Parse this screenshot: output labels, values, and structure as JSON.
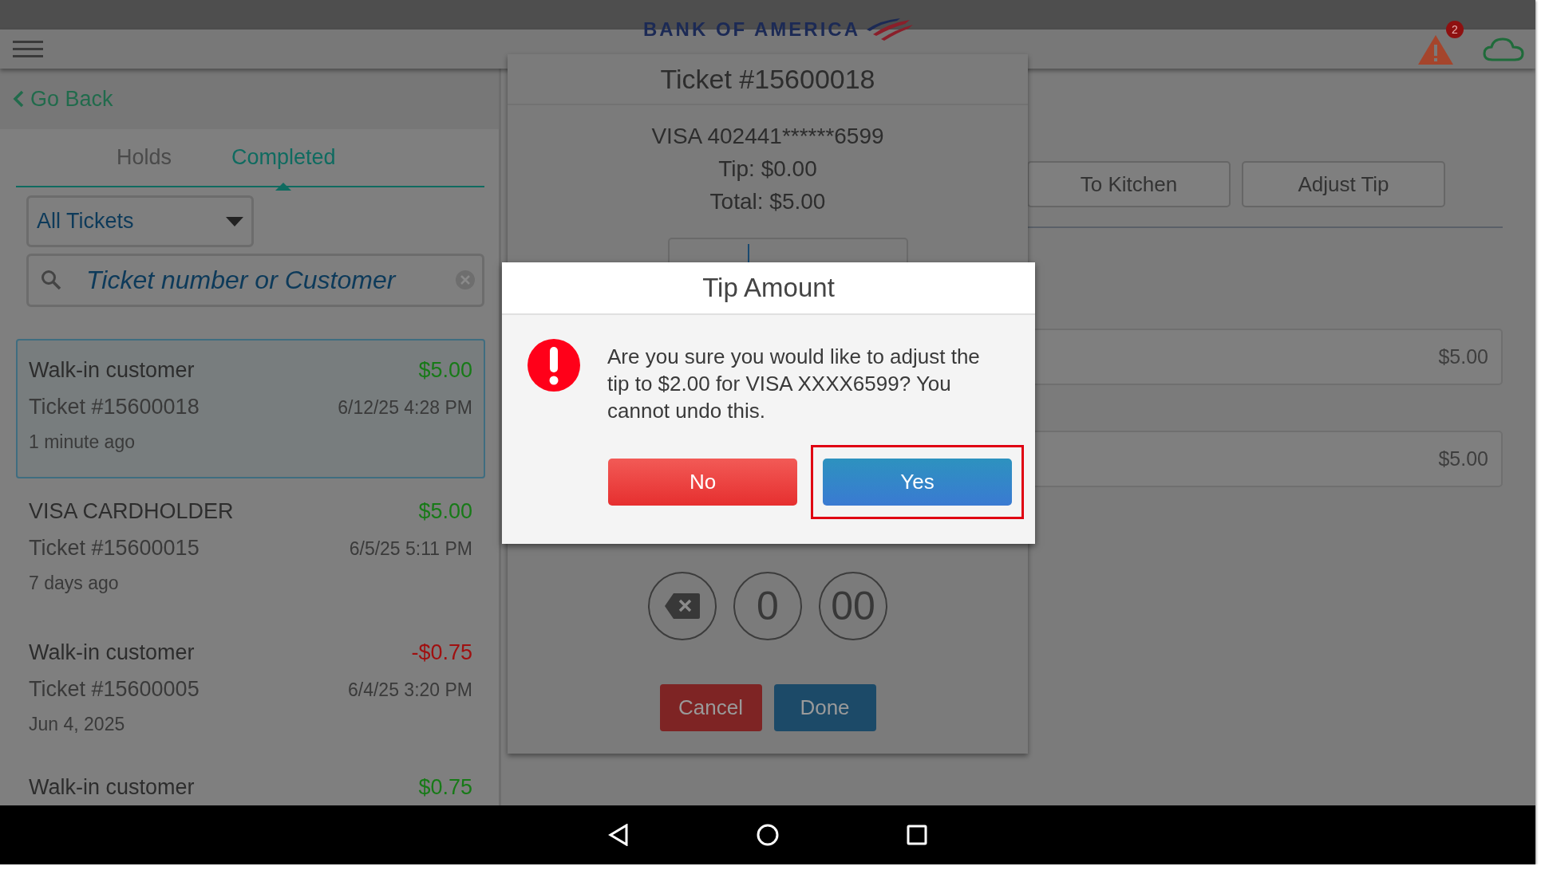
{
  "app_bar": {
    "logo_text": "BANK OF AMERICA",
    "alert_count": "2"
  },
  "back_link": "Go Back",
  "tabs": [
    {
      "label": "Holds",
      "selected": false
    },
    {
      "label": "Completed",
      "selected": true
    }
  ],
  "filter": {
    "value": "All Tickets"
  },
  "search": {
    "placeholder": "Ticket number or Customer"
  },
  "tickets": [
    {
      "customer": "Walk-in customer",
      "amount": "$5.00",
      "color": "#177a17",
      "ticket": "Ticket #15600018",
      "datetime": "6/12/25 4:28 PM",
      "age": "1 minute ago",
      "selected": true
    },
    {
      "customer": "VISA CARDHOLDER",
      "amount": "$5.00",
      "color": "#177a17",
      "ticket": "Ticket #15600015",
      "datetime": "6/5/25 5:11 PM",
      "age": "7 days ago",
      "selected": false
    },
    {
      "customer": "Walk-in customer",
      "amount": "-$0.75",
      "color": "#a01010",
      "ticket": "Ticket #15600005",
      "datetime": "6/4/25 3:20 PM",
      "age": "Jun 4, 2025",
      "selected": false
    },
    {
      "customer": "Walk-in customer",
      "amount": "$0.75",
      "color": "#177a17",
      "selected": false
    }
  ],
  "ticket_panel": {
    "title": "Ticket #15600018",
    "card": "VISA 402441******6599",
    "tip": "Tip: $0.00",
    "total": "Total: $5.00",
    "keypad": [
      {
        "kind": "backspace"
      },
      {
        "kind": "digit",
        "label": "0"
      },
      {
        "kind": "digit",
        "label": "00"
      }
    ],
    "buttons": [
      {
        "label": "Cancel",
        "kind": "danger"
      },
      {
        "label": "Done",
        "kind": "primary"
      }
    ]
  },
  "actions": [
    "To Kitchen",
    "Adjust Tip"
  ],
  "line_items": [
    {
      "amount": "$5.00"
    },
    {
      "amount": "$5.00"
    }
  ],
  "dialog": {
    "title": "Tip Amount",
    "message": "Are you sure you would like to adjust the tip to $2.00 for VISA XXXX6599? You cannot undo this.",
    "buttons": [
      {
        "label": "No",
        "kind": "danger",
        "highlighted": false
      },
      {
        "label": "Yes",
        "kind": "primary",
        "highlighted": true
      }
    ]
  }
}
